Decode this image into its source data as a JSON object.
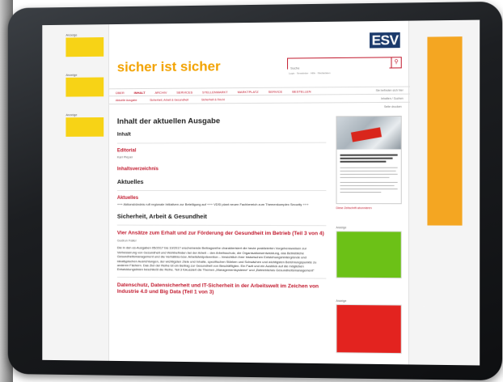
{
  "left_ads": [
    {
      "label": "Anzeige"
    },
    {
      "label": "Anzeige"
    },
    {
      "label": "Anzeige"
    }
  ],
  "header": {
    "publisher_logo": "ESV",
    "brand": "sicher ist sicher",
    "search_placeholder": "Suche",
    "sublinks": "Login · Newsletter · Hilfe · Mediadaten"
  },
  "nav": {
    "items": [
      "Über",
      "Inhalt",
      "Archiv",
      "Services",
      "Stellenmarkt",
      "Marktplatz",
      "Service",
      "Bestellen"
    ],
    "active_index": 1,
    "right": "Sie befinden sich hier"
  },
  "subnav": {
    "items": [
      "Aktuelle Ausgabe",
      "Sicherheit, Arbeit & Gesundheit",
      "Sicherheit & Recht"
    ],
    "right": "Inhalten / Suchen"
  },
  "print_link": "Seite drucken",
  "article": {
    "title": "Inhalt der aktuellen Ausgabe",
    "section_inhalt": "Inhalt",
    "editorial_title": "Editorial",
    "editorial_author": "Karl Pieper",
    "toc_title": "Inhaltsverzeichnis",
    "section_aktuelles": "Aktuelles",
    "aktuelles_title": "Aktuelles",
    "aktuelles_teaser": "+++ Aktionsbündnis ruft regionale Initiativen zur Beteiligung auf +++ VDSI plant neuen Fachbereich zum Themenkomplex Security +++",
    "section_saug": "Sicherheit, Arbeit & Gesundheit",
    "article1_title": "Vier Ansätze zum Erhalt und zur Förderung der Gesundheit im Betrieb (Teil 3 von 4)",
    "article1_author": "Gudrun Faller",
    "article1_teaser": "Die in den es-Ausgaben 05/2017 bis 10/2017 erscheinende Beitragsreihe charakterisiert die heute praktizierten Vorgehensweisen zur Verbesserung von Gesundheit und Wohlbefinden bei der Arbeit – den Arbeitsschutz, die Organisationsentwicklung, das Betriebliche Gesundheitsmanagement und die Verhältnis-bzw. Arbeitsfeldprävention – hinsichtlich ihrer historischen Entstehungshintergründe und idealtypischen Ausrichtungen, der wichtigsten Ziele und Inhalte, spezifischen Stärken und Schwächen und wichtigsten Berührungspunkte zu anderen Fächern. Das Ziel der Reihe ist ein Beitrag zur Gesundheit von Beschäftigten. Ein Fazit und ein Ausblick auf die möglichen Entwicklungslinien beschließt die Reihe. Teil 3 fokussiert die Themen „Managementsysteme“ und „Betriebliches Gesundheitsmanagement“",
    "article2_title": "Datenschutz, Datensicherheit und IT-Sicherheit in der Arbeitswelt im Zeichen von Industrie 4.0 und Big Data (Teil 1 von 3)"
  },
  "sidebar": {
    "cover_link": "Diese Zeitschrift abonnieren",
    "ad1_label": "Anzeige",
    "ad2_label": "Anzeige"
  },
  "colors": {
    "brand_orange": "#f2a200",
    "accent_red": "#c21b2f",
    "ad_yellow": "#f7d316",
    "ad_green": "#6cc117",
    "ad_red": "#e3231f",
    "ad_orange": "#f4a622"
  }
}
